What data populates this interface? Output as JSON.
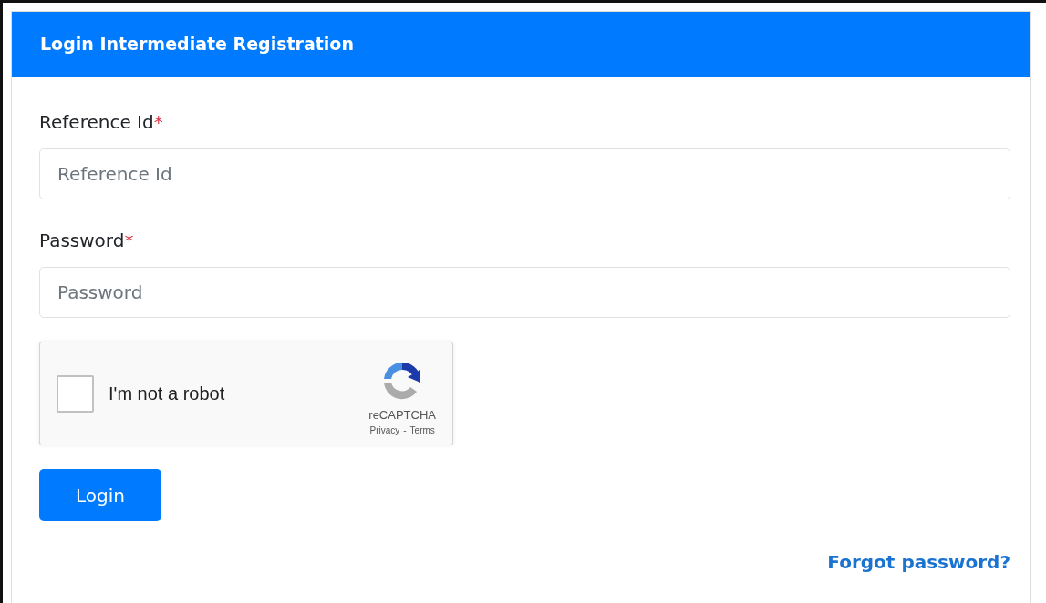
{
  "card": {
    "title": "Login Intermediate Registration"
  },
  "fields": [
    {
      "label": "Reference Id",
      "required_mark": "*",
      "placeholder": "Reference Id"
    },
    {
      "label": "Password",
      "required_mark": "*",
      "placeholder": "Password"
    }
  ],
  "captcha": {
    "checked": false,
    "label": "I'm not a robot",
    "brand": "reCAPTCHA",
    "privacy": "Privacy",
    "separator": "-",
    "terms": "Terms"
  },
  "login_button": "Login",
  "forgot_link": "Forgot password?"
}
